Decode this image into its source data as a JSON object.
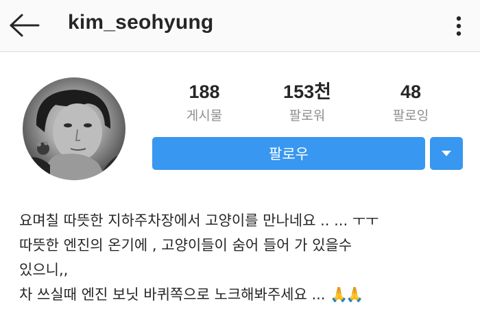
{
  "header": {
    "username": "kim_seohyung",
    "back_icon": "arrow-left-icon",
    "more_icon": "more-vertical-icon"
  },
  "profile": {
    "avatar_icon": "profile-photo",
    "stats": [
      {
        "value": "188",
        "label": "게시물"
      },
      {
        "value": "153천",
        "label": "팔로워"
      },
      {
        "value": "48",
        "label": "팔로잉"
      }
    ],
    "follow_label": "팔로우",
    "dropdown_icon": "triangle-down-icon"
  },
  "bio": {
    "lines": [
      "요며칠 따뜻한 지하주차장에서 고양이를 만나네요 .. ...  ㅜㅜ",
      "따뜻한 엔진의 온기에 , 고양이들이 숨어 들어 가 있을수",
      "있으니,,",
      "차 쓰실때 엔진 보닛 바퀴쪽으로 노크해봐주세요 ..."
    ],
    "emoji": "🙏🙏"
  },
  "colors": {
    "accent": "#3897f0",
    "muted_text": "#8e8e8e",
    "text": "#262626",
    "topbar_bg": "#fafafa"
  }
}
